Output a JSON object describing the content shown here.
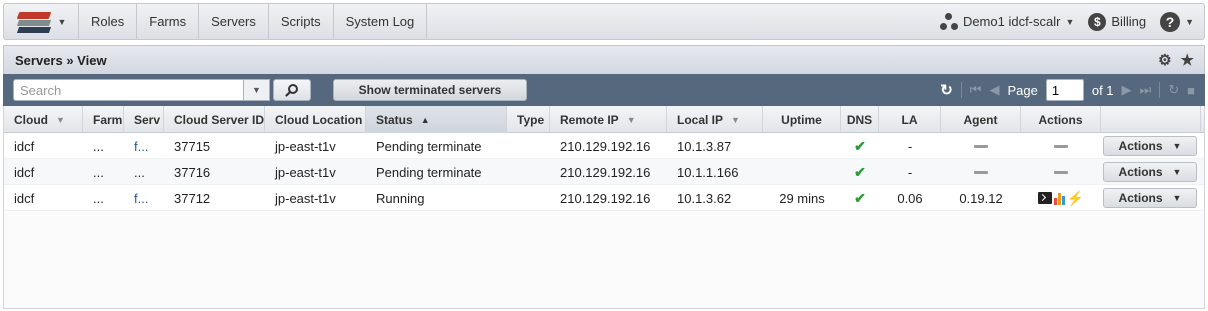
{
  "nav": {
    "items": [
      "Roles",
      "Farms",
      "Servers",
      "Scripts",
      "System Log"
    ],
    "account": "Demo1 idcf-scalr",
    "billing": "Billing"
  },
  "panel": {
    "title": "Servers » View"
  },
  "toolbar": {
    "search_placeholder": "Search",
    "show_terminated": "Show terminated servers",
    "page_label": "Page",
    "page_value": "1",
    "of_label": "of 1"
  },
  "columns": {
    "cloud": "Cloud",
    "farm": "Farm",
    "server": "Serv",
    "cloud_server_id": "Cloud Server ID",
    "cloud_location": "Cloud Location",
    "status": "Status",
    "type": "Type",
    "remote_ip": "Remote IP",
    "local_ip": "Local IP",
    "uptime": "Uptime",
    "dns": "DNS",
    "la": "LA",
    "agent": "Agent",
    "actions": "Actions"
  },
  "rows": [
    {
      "cloud": "idcf",
      "farm": "...",
      "server": "f...",
      "cloud_server_id": "37715",
      "cloud_location": "jp-east-t1v",
      "status": "Pending terminate",
      "type": "",
      "remote_ip": "210.129.192.16",
      "local_ip": "10.1.3.87",
      "uptime": "",
      "dns": "✔",
      "la": "-",
      "agent": "",
      "action_label": "Actions"
    },
    {
      "cloud": "idcf",
      "farm": "...",
      "server": "...",
      "cloud_server_id": "37716",
      "cloud_location": "jp-east-t1v",
      "status": "Pending terminate",
      "type": "",
      "remote_ip": "210.129.192.16",
      "local_ip": "10.1.1.166",
      "uptime": "",
      "dns": "✔",
      "la": "-",
      "agent": "",
      "action_label": "Actions"
    },
    {
      "cloud": "idcf",
      "farm": "...",
      "server": "f...",
      "cloud_server_id": "37712",
      "cloud_location": "jp-east-t1v",
      "status": "Running",
      "type": "",
      "remote_ip": "210.129.192.16",
      "local_ip": "10.1.3.62",
      "uptime": "29 mins",
      "dns": "✔",
      "la": "0.06",
      "agent": "0.19.12",
      "action_label": "Actions"
    }
  ]
}
